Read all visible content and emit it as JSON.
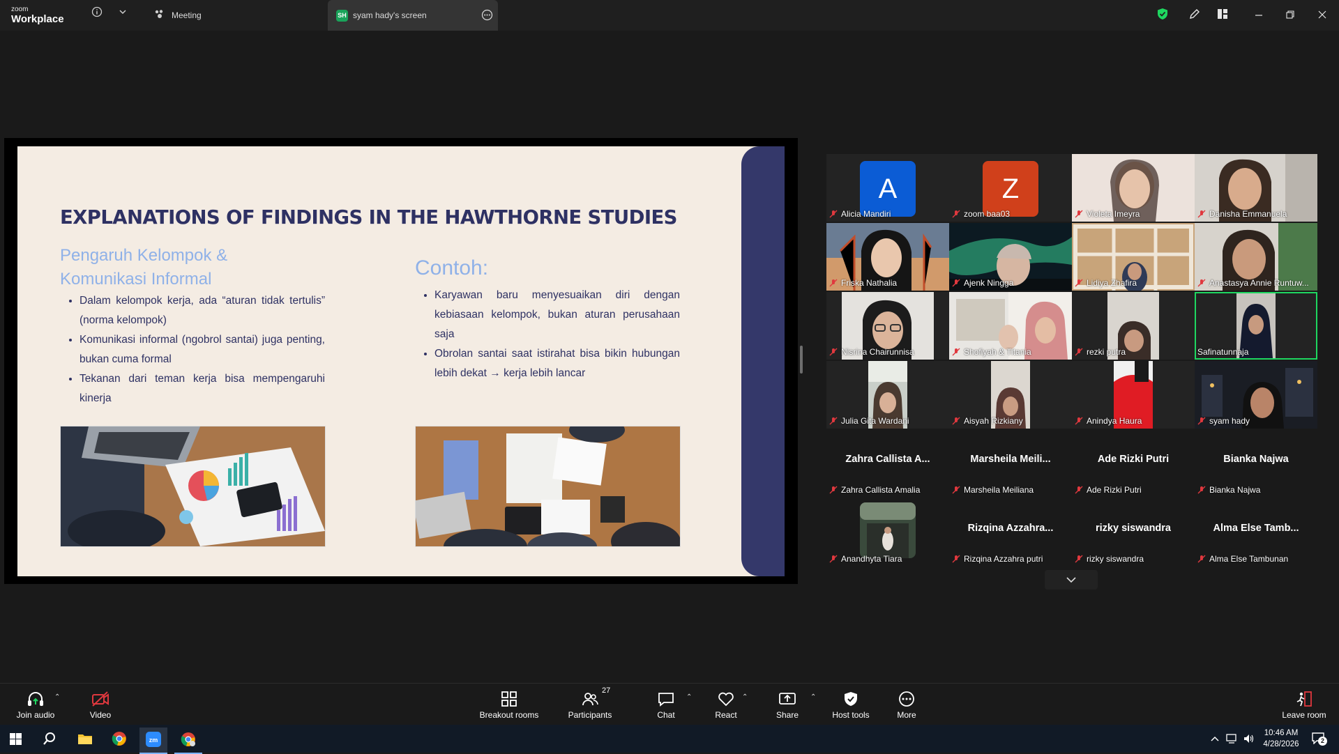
{
  "titlebar": {
    "brand_small": "zoom",
    "brand_big": "Workplace",
    "tabs": [
      {
        "label": "Meeting"
      },
      {
        "label": "syam hady's screen",
        "badge": "SH"
      }
    ]
  },
  "slide": {
    "title": "EXPLANATIONS OF FINDINGS IN THE HAWTHORNE STUDIES",
    "left_heading_1": "Pengaruh Kelompok &",
    "left_heading_2": "Komunikasi Informal",
    "left_bullets": [
      "Dalam kelompok kerja, ada “aturan tidak tertulis” (norma kelompok)",
      "Komunikasi informal (ngobrol santai) juga penting, bukan cuma formal",
      "Tekanan dari teman kerja bisa mempengaruhi kinerja"
    ],
    "right_heading": "Contoh:",
    "right_bullets": [
      "Karyawan baru menyesuaikan diri dengan kebiasaan kelompok, bukan aturan perusahaan saja",
      "Obrolan santai saat istirahat bisa bikin hubungan lebih dekat → kerja lebih lancar"
    ]
  },
  "participants": [
    {
      "name": "Alicia Mandiri",
      "avatar": "A",
      "avatar_color": "#0b5cd5"
    },
    {
      "name": "zoom baa03",
      "avatar": "Z",
      "avatar_color": "#d0401b"
    },
    {
      "name": "Violeta Imeyra"
    },
    {
      "name": "Danisha Emmanuela"
    },
    {
      "name": "Friska Nathalia"
    },
    {
      "name": "Ajenk Ningga"
    },
    {
      "name": "Lidiya Zhafira"
    },
    {
      "name": "Anastasya Annie Runtuw..."
    },
    {
      "name": "Nisrina Chairunnisa"
    },
    {
      "name": "Shofiyah & Titania"
    },
    {
      "name": "rezki putra"
    },
    {
      "name": "Safinatunnaja"
    },
    {
      "name": "Julia Gita Wardani"
    },
    {
      "name": "Aisyah Rizkiany"
    },
    {
      "name": "Anindya Haura"
    },
    {
      "name": "syam hady"
    },
    {
      "name": "Zahra Callista Amalia",
      "display": "Zahra Callista A..."
    },
    {
      "name": "Marsheila Meiliana",
      "display": "Marsheila Meili..."
    },
    {
      "name": "Ade Rizki Putri",
      "display": "Ade Rizki Putri"
    },
    {
      "name": "Bianka Najwa",
      "display": "Bianka Najwa"
    },
    {
      "name": "Anandhyta Tiara"
    },
    {
      "name": "Rizqina Azzahra putri",
      "display": "Rizqina Azzahra..."
    },
    {
      "name": "rizky siswandra",
      "display": "rizky siswandra"
    },
    {
      "name": "Alma Else Tambunan",
      "display": "Alma Else Tamb..."
    }
  ],
  "toolbar": {
    "join_audio": "Join audio",
    "video": "Video",
    "breakout": "Breakout rooms",
    "participants": "Participants",
    "participants_count": "27",
    "chat": "Chat",
    "react": "React",
    "share": "Share",
    "host_tools": "Host tools",
    "more": "More",
    "leave": "Leave room"
  },
  "taskbar": {
    "time": "10:46 AM",
    "date": "4/28/2026",
    "notifications": "2"
  },
  "colors": {
    "accent_green": "#1ed760",
    "slide_navy": "#2e3163",
    "slide_blue": "#8fb1e8",
    "mute_red": "#e0383e"
  }
}
